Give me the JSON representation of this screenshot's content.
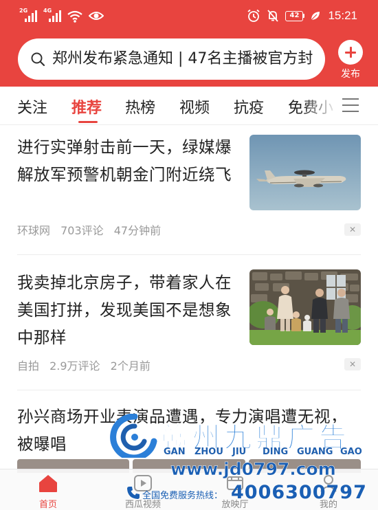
{
  "status_bar": {
    "sim1_label": "2G",
    "sim2_label": "4G",
    "battery": "42",
    "time": "15:21"
  },
  "search": {
    "query": "郑州发布紧急通知 | 47名主播被官方封"
  },
  "publish_label": "发布",
  "tabs": [
    "关注",
    "推荐",
    "热榜",
    "视频",
    "抗疫",
    "免费小"
  ],
  "active_tab": "推荐",
  "articles": [
    {
      "title": "进行实弹射击前一天，绿媒爆解放军预警机朝金门附近绕飞",
      "source": "环球网",
      "comments": "703评论",
      "time": "47分钟前",
      "thumb_icon": "aircraft-photo"
    },
    {
      "title": "我卖掉北京房子，带着家人在美国打拼，发现美国不是想象中那样",
      "source": "自拍",
      "comments": "2.9万评论",
      "time": "2个月前",
      "thumb_icon": "family-photo"
    },
    {
      "title": "孙兴商场开业表演品遭遇，专力演唱遭无视，被曝唱"
    }
  ],
  "watermark": {
    "brand_cn": "赣州九鼎广告",
    "pinyin": [
      "GAN",
      "ZHOU",
      "JIU",
      "DING",
      "GUANG",
      "GAO"
    ],
    "url": "www.jd0797.com",
    "hotline_label": "全国免费服务热线：",
    "hotline_number": "4006300797"
  },
  "bottom_nav": [
    {
      "label": "首页",
      "icon": "home-icon",
      "active": true
    },
    {
      "label": "西瓜视频",
      "icon": "play-icon",
      "active": false
    },
    {
      "label": "放映厅",
      "icon": "film-icon",
      "active": false
    },
    {
      "label": "我的",
      "icon": "user-icon",
      "active": false
    }
  ],
  "colors": {
    "brand_red": "#e8443f",
    "watermark_blue": "#2b7fd8"
  }
}
